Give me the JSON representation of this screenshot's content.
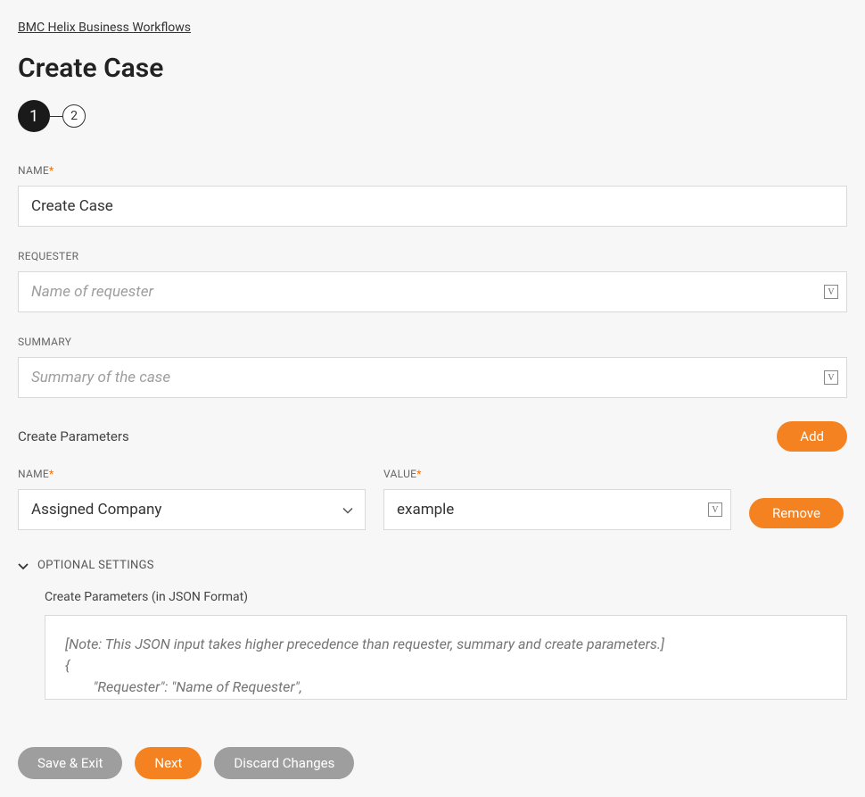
{
  "breadcrumb": "BMC Helix Business Workflows",
  "page_title": "Create Case",
  "stepper": {
    "current": "1",
    "next": "2"
  },
  "fields": {
    "name": {
      "label": "NAME",
      "value": "Create Case"
    },
    "requester": {
      "label": "REQUESTER",
      "placeholder": "Name of requester",
      "value": ""
    },
    "summary": {
      "label": "SUMMARY",
      "placeholder": "Summary of the case",
      "value": ""
    }
  },
  "params_section": {
    "title": "Create Parameters",
    "add_label": "Add",
    "name_label": "NAME",
    "value_label": "VALUE",
    "name_value": "Assigned Company",
    "value_value": "example",
    "remove_label": "Remove"
  },
  "optional": {
    "header": "OPTIONAL SETTINGS",
    "json_label": "Create Parameters (in JSON Format)",
    "json_placeholder": "[Note: This JSON input takes higher precedence than requester, summary and create parameters.]\n{\n        \"Requester\": \"Name of Requester\","
  },
  "footer": {
    "save_exit": "Save & Exit",
    "next": "Next",
    "discard": "Discard Changes"
  }
}
